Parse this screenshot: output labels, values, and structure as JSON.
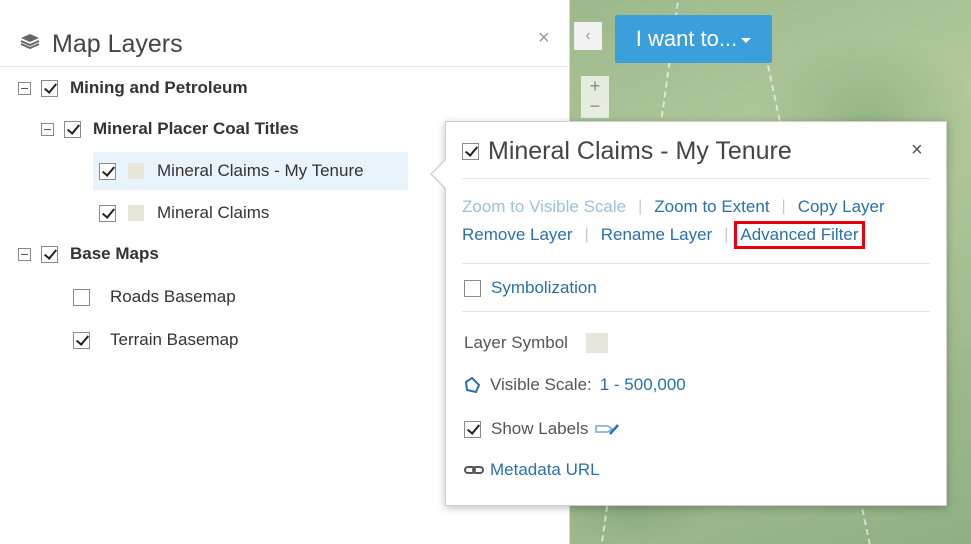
{
  "panel": {
    "title": "Map Layers",
    "close_glyph": "×",
    "icon": "layers-icon"
  },
  "tree": {
    "group1": {
      "label": "Mining and Petroleum",
      "checked": true
    },
    "subgroup1": {
      "label": "Mineral Placer Coal Titles",
      "checked": true
    },
    "layer1": {
      "label": "Mineral Claims - My Tenure",
      "checked": true,
      "selected": true
    },
    "layer2": {
      "label": "Mineral Claims",
      "checked": true
    },
    "group2": {
      "label": "Base Maps",
      "checked": true
    },
    "layer3": {
      "label": "Roads Basemap",
      "checked": false
    },
    "layer4": {
      "label": "Terrain Basemap",
      "checked": true
    }
  },
  "map": {
    "toggle_glyph": "‹",
    "zoom_in": "+",
    "zoom_out": "−",
    "want_button": "I want to..."
  },
  "popup": {
    "title": "Mineral Claims - My Tenure",
    "close_glyph": "×",
    "actions": {
      "zoom_visible": "Zoom to Visible Scale",
      "zoom_extent": "Zoom to Extent",
      "copy_layer": "Copy Layer",
      "remove_layer": "Remove Layer",
      "rename_layer": "Rename Layer",
      "advanced_filter": "Advanced Filter"
    },
    "symbolization": "Symbolization",
    "layer_symbol": "Layer Symbol",
    "visible_scale_label": "Visible Scale:",
    "visible_scale_value": "1 - 500,000",
    "show_labels": "Show Labels",
    "metadata": "Metadata URL"
  },
  "colors": {
    "accent": "#3b9fdb",
    "link": "#2a6fae",
    "highlight": "#e8000c"
  }
}
